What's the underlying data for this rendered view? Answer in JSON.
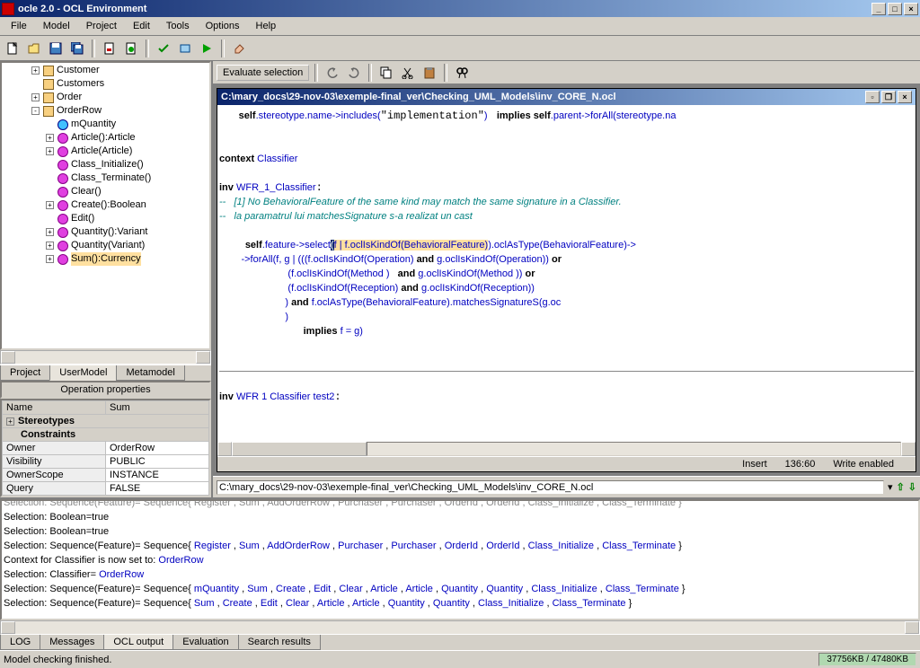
{
  "title": "ocle 2.0 - OCL Environment",
  "menus": [
    "File",
    "Model",
    "Project",
    "Edit",
    "Tools",
    "Options",
    "Help"
  ],
  "evalBtn": "Evaluate selection",
  "tree": {
    "items": [
      {
        "indent": 2,
        "exp": "+",
        "icon": "cls",
        "label": "Customer"
      },
      {
        "indent": 2,
        "exp": " ",
        "icon": "cls",
        "label": "Customers"
      },
      {
        "indent": 2,
        "exp": "+",
        "icon": "cls",
        "label": "Order"
      },
      {
        "indent": 2,
        "exp": "-",
        "icon": "cls",
        "label": "OrderRow"
      },
      {
        "indent": 3,
        "exp": " ",
        "icon": "attr",
        "label": "mQuantity"
      },
      {
        "indent": 3,
        "exp": "+",
        "icon": "op",
        "label": "Article():Article"
      },
      {
        "indent": 3,
        "exp": "+",
        "icon": "op",
        "label": "Article(Article)"
      },
      {
        "indent": 3,
        "exp": " ",
        "icon": "op",
        "label": "Class_Initialize()"
      },
      {
        "indent": 3,
        "exp": " ",
        "icon": "op",
        "label": "Class_Terminate()"
      },
      {
        "indent": 3,
        "exp": " ",
        "icon": "op",
        "label": "Clear()"
      },
      {
        "indent": 3,
        "exp": "+",
        "icon": "op",
        "label": "Create():Boolean"
      },
      {
        "indent": 3,
        "exp": " ",
        "icon": "op",
        "label": "Edit()"
      },
      {
        "indent": 3,
        "exp": "+",
        "icon": "op",
        "label": "Quantity():Variant"
      },
      {
        "indent": 3,
        "exp": "+",
        "icon": "op",
        "label": "Quantity(Variant)"
      },
      {
        "indent": 3,
        "exp": "+",
        "icon": "op",
        "label": "Sum():Currency",
        "sel": true
      }
    ]
  },
  "leftTabs": [
    "Project",
    "UserModel",
    "Metamodel"
  ],
  "propsTitle": "Operation properties",
  "props": {
    "headers": [
      "Name",
      "Sum"
    ],
    "stereo": "Stereotypes",
    "constraints": "Constraints",
    "rows": [
      [
        "Owner",
        "OrderRow"
      ],
      [
        "Visibility",
        "PUBLIC"
      ],
      [
        "OwnerScope",
        "INSTANCE"
      ],
      [
        "Query",
        "FALSE"
      ]
    ]
  },
  "docPath": "C:\\mary_docs\\29-nov-03\\exemple-final_ver\\Checking_UML_Models\\inv_CORE_N.ocl",
  "code": {
    "l1a": "self",
    "l1b": ".stereotype.name->includes(",
    "l1c": "\"implementation\"",
    "l1d": ") ",
    "l1e": "implies",
    "l1f": " self",
    "l1g": ".parent->forAll(stereotype.na",
    "l2a": "context",
    "l2b": " Classifier",
    "l3a": "inv",
    "l3b": " WFR_1_Classifier",
    "l3c": ":",
    "l4": "--   [1] No BehavioralFeature of the same kind may match the same signature in a Classifier.",
    "l5": "--   la paramatrul lui matchesSignature s-a realizat un cast",
    "l6a": "self",
    "l6b": ".feature->select",
    "l6c": "(",
    "l6d": "f | f.oclIsKindOf(BehavioralFeature)",
    "l6e": ").oclAsType(BehavioralFeature)->",
    "l7": "        ->forAll(f, g | (((f.oclIsKindOf(Operation) ",
    "l7b": "and",
    "l7c": " g.oclIsKindOf(Operation)) ",
    "l7d": "or",
    "l8": "                         (f.oclIsKindOf(Method )   ",
    "l8b": "and",
    "l8c": " g.oclIsKindOf(Method )) ",
    "l8d": "or",
    "l9": "                         (f.oclIsKindOf(Reception) ",
    "l9b": "and",
    "l9c": " g.oclIsKindOf(Reception))",
    "l10": "                        ) ",
    "l10b": "and",
    "l10c": " f.oclAsType(BehavioralFeature).matchesSignatureS(g.oc",
    "l11": "                        )",
    "l12a": "implies",
    "l12b": " f = g)",
    "l13a": "inv",
    "l13b": " WFR 1 Classifier test2",
    "l13c": ":"
  },
  "status": {
    "mode": "Insert",
    "pos": "136:60",
    "rw": "Write enabled"
  },
  "output": {
    "l0": "Selection: Sequence(Feature)= Sequence{ Register , Sum , AddOrderRow , Purchaser , Purchaser , OrderId , OrderId , Class_Initialize , Class_Terminate }",
    "l1": "Selection: Boolean=true",
    "l2": "Selection: Boolean=true",
    "l3a": "Selection: Sequence(Feature)= Sequence{ ",
    "l3b": [
      "Register",
      "Sum",
      "AddOrderRow",
      "Purchaser",
      "Purchaser",
      "OrderId",
      "OrderId",
      "Class_Initialize",
      "Class_Terminate"
    ],
    "l3c": " }",
    "l4a": "Context for Classifier is now set to: ",
    "l4b": "OrderRow",
    "l5a": "Selection: Classifier= ",
    "l5b": "OrderRow",
    "l6a": "Selection: Sequence(Feature)= Sequence{ ",
    "l6b": [
      "mQuantity",
      "Sum",
      "Create",
      "Edit",
      "Clear",
      "Article",
      "Article",
      "Quantity",
      "Quantity",
      "Class_Initialize",
      "Class_Terminate"
    ],
    "l6c": " }",
    "l7a": "Selection: Sequence(Feature)= Sequence{ ",
    "l7b": [
      "Sum",
      "Create",
      "Edit",
      "Clear",
      "Article",
      "Article",
      "Quantity",
      "Quantity",
      "Class_Initialize",
      "Class_Terminate"
    ],
    "l7c": " }"
  },
  "bottomTabs": [
    "LOG",
    "Messages",
    "OCL output",
    "Evaluation",
    "Search results"
  ],
  "statusMsg": "Model checking finished.",
  "memStatus": "37756KB / 47480KB"
}
